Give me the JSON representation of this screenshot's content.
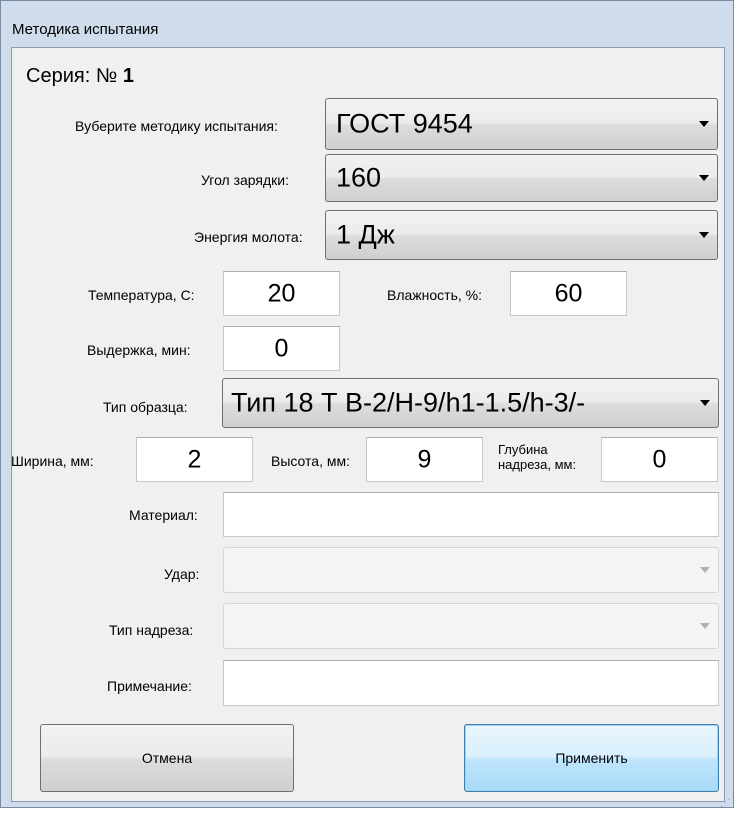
{
  "window": {
    "title": "Методика испытания"
  },
  "series": {
    "label": "Серия: №",
    "number": "1"
  },
  "fields": {
    "method": {
      "label": "Вуберите методику испытания:",
      "value": "ГОСТ 9454"
    },
    "angle": {
      "label": "Угол зарядки:",
      "value": "160"
    },
    "energy": {
      "label": "Энергия молота:",
      "value": "1 Дж"
    },
    "temperature": {
      "label": "Температура, С:",
      "value": "20"
    },
    "humidity": {
      "label": "Влажность, %:",
      "value": "60"
    },
    "hold": {
      "label": "Выдержка, мин:",
      "value": "0"
    },
    "sample_type": {
      "label": "Тип образца:",
      "value": "Тип 18 Т В-2/Н-9/h1-1.5/h-3/-"
    },
    "width": {
      "label": "Ширина, мм:",
      "value": "2"
    },
    "height": {
      "label": "Высота, мм:",
      "value": "9"
    },
    "notch_depth": {
      "label": "Глубина надреза, мм:",
      "label_line1": "Глубина",
      "label_line2": "надреза, мм:",
      "value": "0"
    },
    "material": {
      "label": "Материал:",
      "value": ""
    },
    "impact": {
      "label": "Удар:",
      "value": ""
    },
    "notch_type": {
      "label": "Тип надреза:",
      "value": ""
    },
    "note": {
      "label": "Примечание:",
      "value": ""
    }
  },
  "buttons": {
    "cancel": "Отмена",
    "apply": "Применить"
  },
  "icons": {
    "dropdown": "chevron-down-icon",
    "resize": "resize-grip-icon"
  }
}
